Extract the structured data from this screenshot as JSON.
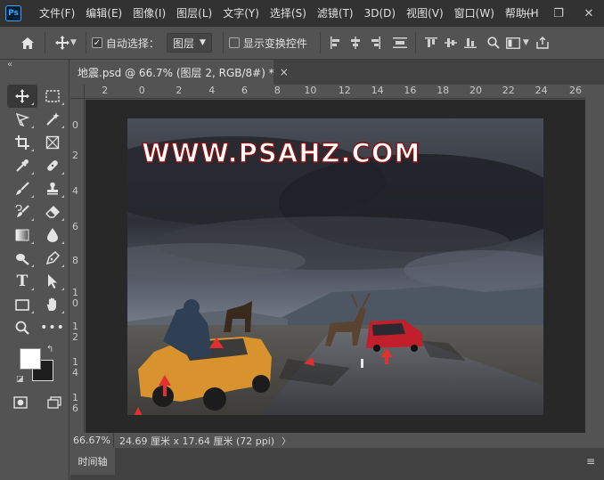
{
  "app": {
    "logo": "Ps"
  },
  "menu": [
    "文件(F)",
    "编辑(E)",
    "图像(I)",
    "图层(L)",
    "文字(Y)",
    "选择(S)",
    "滤镜(T)",
    "3D(D)",
    "视图(V)",
    "窗口(W)",
    "帮助(H"
  ],
  "window_controls": {
    "minimize": "—",
    "restore": "❐",
    "close": "✕"
  },
  "options": {
    "auto_select_label": "自动选择：",
    "auto_select_checked": true,
    "layer_target": "图层",
    "show_transform_label": "显示变换控件",
    "show_transform_checked": false
  },
  "document": {
    "tab_title": "地震.psd @ 66.7% (图层 2, RGB/8#) *",
    "close_symbol": "×",
    "watermark": "WWW.PSAHZ.COM"
  },
  "ruler_top": [
    "2",
    "0",
    "2",
    "4",
    "6",
    "8",
    "10",
    "12",
    "14",
    "16",
    "18",
    "20",
    "22",
    "24",
    "26"
  ],
  "ruler_left": [
    "0",
    "2",
    "4",
    "6",
    "8",
    "1 0",
    "1 2",
    "1 4",
    "1 6"
  ],
  "status": {
    "zoom": "66.67%",
    "doc_size": "24.69 厘米 x 17.64 厘米 (72 ppi)",
    "arrow": "〉"
  },
  "timeline": {
    "tab_label": "时间轴",
    "menu_symbol": "≡"
  },
  "colors": {
    "foreground": "#ffffff",
    "background": "#1e1e1e",
    "accent": "#31a8ff"
  },
  "icons": {
    "tools": [
      "move-icon",
      "marquee-icon",
      "lasso-icon",
      "magic-wand-icon",
      "crop-icon",
      "frame-icon",
      "eyedropper-icon",
      "healing-icon",
      "brush-icon",
      "stamp-icon",
      "history-brush-icon",
      "eraser-icon",
      "gradient-icon",
      "blur-icon",
      "dodge-icon",
      "pen-icon",
      "type-icon",
      "path-select-icon",
      "rectangle-icon",
      "hand-icon",
      "zoom-icon",
      "more-icon"
    ]
  }
}
